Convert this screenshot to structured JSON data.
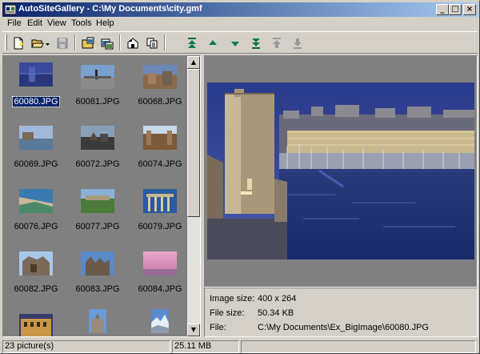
{
  "window": {
    "title": "AutoSiteGallery - C:\\My Documents\\city.gmf",
    "minimize_glyph": "_",
    "maximize_glyph": "□",
    "close_glyph": "×"
  },
  "menu": [
    {
      "label": "File"
    },
    {
      "label": "Edit"
    },
    {
      "label": "View"
    },
    {
      "label": "Tools"
    },
    {
      "label": "Help"
    }
  ],
  "toolbar": {
    "icons": [
      "new-icon",
      "open-icon",
      "dropdown-arrow-icon",
      "save-icon",
      "add-images-icon",
      "remove-images-icon",
      "properties-icon",
      "copy-icon",
      "move-top-icon",
      "move-up-icon",
      "move-down-icon",
      "move-bottom-icon",
      "move-top-disabled-icon",
      "move-bottom-disabled-icon"
    ]
  },
  "thumbnails": [
    {
      "name": "60080.JPG",
      "selected": true
    },
    {
      "name": "60081.JPG"
    },
    {
      "name": "60068.JPG"
    },
    {
      "name": "60069.JPG"
    },
    {
      "name": "60072.JPG"
    },
    {
      "name": "60074.JPG"
    },
    {
      "name": "60076.JPG"
    },
    {
      "name": "60077.JPG"
    },
    {
      "name": "60079.JPG"
    },
    {
      "name": "60082.JPG"
    },
    {
      "name": "60083.JPG"
    },
    {
      "name": "60084.JPG"
    },
    {
      "name": ""
    },
    {
      "name": ""
    },
    {
      "name": ""
    }
  ],
  "scroll": {
    "up_glyph": "▲",
    "down_glyph": "▼"
  },
  "info": {
    "image_size_label": "Image size:",
    "image_size_value": "400 x 264",
    "file_size_label": "File size:",
    "file_size_value": "50.34 KB",
    "file_label": "File:",
    "file_value": "C:\\My Documents\\Ex_BigImage\\60080.JPG"
  },
  "status": {
    "pictures": "23 picture(s)",
    "total_size": "25.11 MB",
    "extra": ""
  },
  "colors": {
    "title_active": "#0a246a",
    "selection": "#0a246a",
    "pane_bg": "#808080"
  }
}
